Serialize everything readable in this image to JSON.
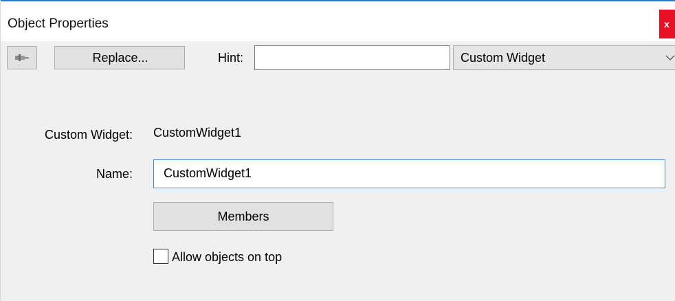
{
  "window": {
    "title": "Object Properties",
    "close_glyph": "x"
  },
  "toolbar": {
    "pin_icon": "pushpin-icon",
    "replace_label": "Replace...",
    "hint_label": "Hint:",
    "hint_value": "",
    "type_selected": "Custom Widget",
    "type_dropdown_icon": "chevron-down-icon"
  },
  "properties": {
    "type_label": "Custom Widget:",
    "type_value": "CustomWidget1",
    "name_label": "Name:",
    "name_value": "CustomWidget1",
    "members_label": "Members",
    "allow_on_top_label": "Allow objects on top",
    "allow_on_top_checked": false
  },
  "colors": {
    "title_accent": "#2b79d0",
    "close_button": "#e81123",
    "focus_border": "#3c8fd5",
    "dialog_background": "#f0f0f0"
  }
}
